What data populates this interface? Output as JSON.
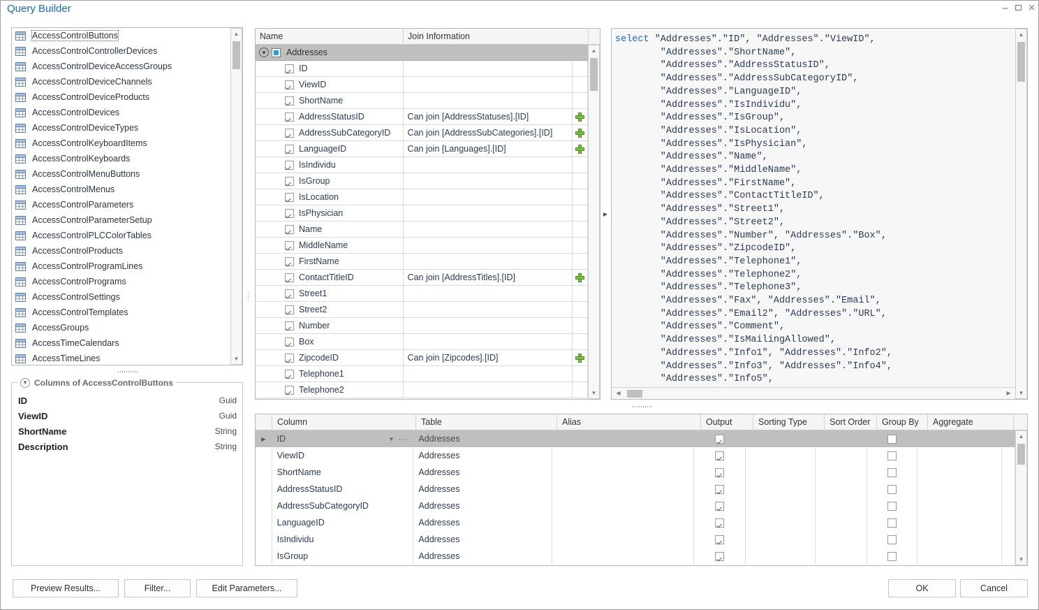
{
  "window": {
    "title": "Query Builder",
    "minimize_label": "minimize-icon",
    "maximize_label": "maximize-icon",
    "close_label": "close-icon"
  },
  "tables_list": {
    "items": [
      "AccessControlButtons",
      "AccessControlControllerDevices",
      "AccessControlDeviceAccessGroups",
      "AccessControlDeviceChannels",
      "AccessControlDeviceProducts",
      "AccessControlDevices",
      "AccessControlDeviceTypes",
      "AccessControlKeyboardItems",
      "AccessControlKeyboards",
      "AccessControlMenuButtons",
      "AccessControlMenus",
      "AccessControlParameters",
      "AccessControlParameterSetup",
      "AccessControlPLCColorTables",
      "AccessControlProducts",
      "AccessControlProgramLines",
      "AccessControlPrograms",
      "AccessControlSettings",
      "AccessControlTemplates",
      "AccessGroups",
      "AccessTimeCalendars",
      "AccessTimeLines"
    ],
    "selected_index": 0
  },
  "columns_group": {
    "title": "Columns of AccessControlButtons",
    "rows": [
      {
        "name": "ID",
        "type": "Guid"
      },
      {
        "name": "ViewID",
        "type": "Guid"
      },
      {
        "name": "ShortName",
        "type": "String"
      },
      {
        "name": "Description",
        "type": "String"
      }
    ]
  },
  "tree": {
    "headers": {
      "name": "Name",
      "join": "Join Information"
    },
    "group": {
      "label": "Addresses",
      "checked": true
    },
    "rows": [
      {
        "name": "ID",
        "checked": true,
        "join": ""
      },
      {
        "name": "ViewID",
        "checked": true,
        "join": ""
      },
      {
        "name": "ShortName",
        "checked": true,
        "join": ""
      },
      {
        "name": "AddressStatusID",
        "checked": true,
        "join": "Can join [AddressStatuses].[ID]"
      },
      {
        "name": "AddressSubCategoryID",
        "checked": true,
        "join": "Can join [AddressSubCategories].[ID]"
      },
      {
        "name": "LanguageID",
        "checked": true,
        "join": "Can join [Languages].[ID]"
      },
      {
        "name": "IsIndividu",
        "checked": true,
        "join": ""
      },
      {
        "name": "IsGroup",
        "checked": true,
        "join": ""
      },
      {
        "name": "IsLocation",
        "checked": true,
        "join": ""
      },
      {
        "name": "IsPhysician",
        "checked": true,
        "join": ""
      },
      {
        "name": "Name",
        "checked": true,
        "join": ""
      },
      {
        "name": "MiddleName",
        "checked": true,
        "join": ""
      },
      {
        "name": "FirstName",
        "checked": true,
        "join": ""
      },
      {
        "name": "ContactTitleID",
        "checked": true,
        "join": "Can join [AddressTitles].[ID]"
      },
      {
        "name": "Street1",
        "checked": true,
        "join": ""
      },
      {
        "name": "Street2",
        "checked": true,
        "join": ""
      },
      {
        "name": "Number",
        "checked": true,
        "join": ""
      },
      {
        "name": "Box",
        "checked": true,
        "join": ""
      },
      {
        "name": "ZipcodeID",
        "checked": true,
        "join": "Can join [Zipcodes].[ID]"
      },
      {
        "name": "Telephone1",
        "checked": true,
        "join": ""
      },
      {
        "name": "Telephone2",
        "checked": true,
        "join": ""
      }
    ]
  },
  "sql": {
    "keyword": "select",
    "body": " \"Addresses\".\"ID\", \"Addresses\".\"ViewID\",\n        \"Addresses\".\"ShortName\",\n        \"Addresses\".\"AddressStatusID\",\n        \"Addresses\".\"AddressSubCategoryID\",\n        \"Addresses\".\"LanguageID\",\n        \"Addresses\".\"IsIndividu\",\n        \"Addresses\".\"IsGroup\",\n        \"Addresses\".\"IsLocation\",\n        \"Addresses\".\"IsPhysician\",\n        \"Addresses\".\"Name\",\n        \"Addresses\".\"MiddleName\",\n        \"Addresses\".\"FirstName\",\n        \"Addresses\".\"ContactTitleID\",\n        \"Addresses\".\"Street1\",\n        \"Addresses\".\"Street2\",\n        \"Addresses\".\"Number\", \"Addresses\".\"Box\",\n        \"Addresses\".\"ZipcodeID\",\n        \"Addresses\".\"Telephone1\",\n        \"Addresses\".\"Telephone2\",\n        \"Addresses\".\"Telephone3\",\n        \"Addresses\".\"Fax\", \"Addresses\".\"Email\",\n        \"Addresses\".\"Email2\", \"Addresses\".\"URL\",\n        \"Addresses\".\"Comment\",\n        \"Addresses\".\"IsMailingAllowed\",\n        \"Addresses\".\"Info1\", \"Addresses\".\"Info2\",\n        \"Addresses\".\"Info3\", \"Addresses\".\"Info4\",\n        \"Addresses\".\"Info5\","
  },
  "grid": {
    "headers": [
      "Column",
      "Table",
      "Alias",
      "Output",
      "Sorting Type",
      "Sort Order",
      "Group By",
      "Aggregate"
    ],
    "rows": [
      {
        "column": "ID",
        "table": "Addresses",
        "alias": "",
        "output": true,
        "sorting_type": "",
        "sort_order": "",
        "group_by": false,
        "aggregate": "",
        "selected": true
      },
      {
        "column": "ViewID",
        "table": "Addresses",
        "alias": "",
        "output": true,
        "sorting_type": "",
        "sort_order": "",
        "group_by": false,
        "aggregate": "",
        "selected": false
      },
      {
        "column": "ShortName",
        "table": "Addresses",
        "alias": "",
        "output": true,
        "sorting_type": "",
        "sort_order": "",
        "group_by": false,
        "aggregate": "",
        "selected": false
      },
      {
        "column": "AddressStatusID",
        "table": "Addresses",
        "alias": "",
        "output": true,
        "sorting_type": "",
        "sort_order": "",
        "group_by": false,
        "aggregate": "",
        "selected": false
      },
      {
        "column": "AddressSubCategoryID",
        "table": "Addresses",
        "alias": "",
        "output": true,
        "sorting_type": "",
        "sort_order": "",
        "group_by": false,
        "aggregate": "",
        "selected": false
      },
      {
        "column": "LanguageID",
        "table": "Addresses",
        "alias": "",
        "output": true,
        "sorting_type": "",
        "sort_order": "",
        "group_by": false,
        "aggregate": "",
        "selected": false
      },
      {
        "column": "IsIndividu",
        "table": "Addresses",
        "alias": "",
        "output": true,
        "sorting_type": "",
        "sort_order": "",
        "group_by": false,
        "aggregate": "",
        "selected": false
      },
      {
        "column": "IsGroup",
        "table": "Addresses",
        "alias": "",
        "output": true,
        "sorting_type": "",
        "sort_order": "",
        "group_by": false,
        "aggregate": "",
        "selected": false
      }
    ]
  },
  "footer": {
    "preview_results": "Preview Results...",
    "filter": "Filter...",
    "edit_parameters": "Edit Parameters...",
    "ok": "OK",
    "cancel": "Cancel"
  }
}
